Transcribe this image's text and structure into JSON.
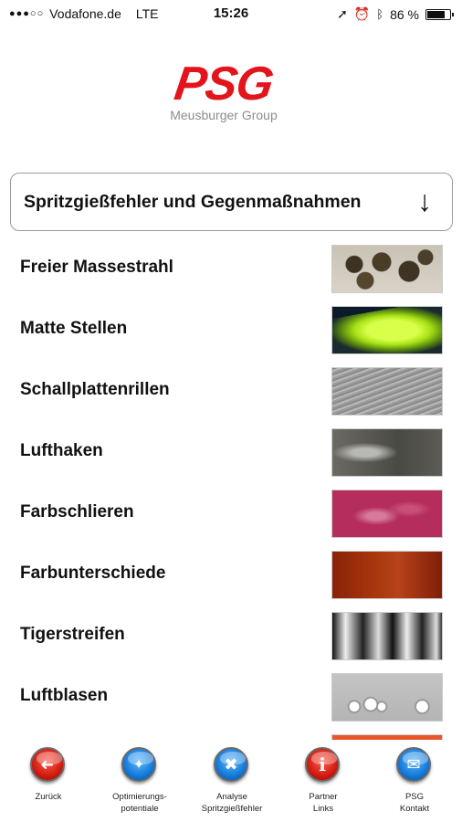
{
  "status_bar": {
    "signal_dots": "●●●○○",
    "carrier": "Vodafone.de",
    "network": "LTE",
    "time": "15:26",
    "location_icon": "location-arrow-icon",
    "alarm_icon": "alarm-icon",
    "bluetooth_icon": "bluetooth-icon",
    "battery_percent": "86 %",
    "battery_level": 0.86
  },
  "logo": {
    "mark": "PSG",
    "subtitle": "Meusburger Group",
    "color": "#e3141b"
  },
  "dropdown": {
    "label": "Spritzgießfehler und Gegenmaßnahmen",
    "arrow": "↓"
  },
  "items": [
    {
      "label": "Freier Massestrahl"
    },
    {
      "label": "Matte Stellen"
    },
    {
      "label": "Schallplattenrillen"
    },
    {
      "label": "Lufthaken"
    },
    {
      "label": "Farbschlieren"
    },
    {
      "label": "Farbunterschiede"
    },
    {
      "label": "Tigerstreifen"
    },
    {
      "label": "Luftblasen"
    }
  ],
  "tabs": [
    {
      "label": "Zurück",
      "icon": "back-arrow-icon",
      "glyph": "➜"
    },
    {
      "label": "Optimierungs-\npotentiale",
      "icon": "lightbulb-icon",
      "glyph": "💡"
    },
    {
      "label": "Analyse\nSpritzgießfehler",
      "icon": "tools-icon",
      "glyph": "✖"
    },
    {
      "label": "Partner\nLinks",
      "icon": "info-icon",
      "glyph": "i"
    },
    {
      "label": "PSG\nKontakt",
      "icon": "mail-icon",
      "glyph": "✉"
    }
  ]
}
